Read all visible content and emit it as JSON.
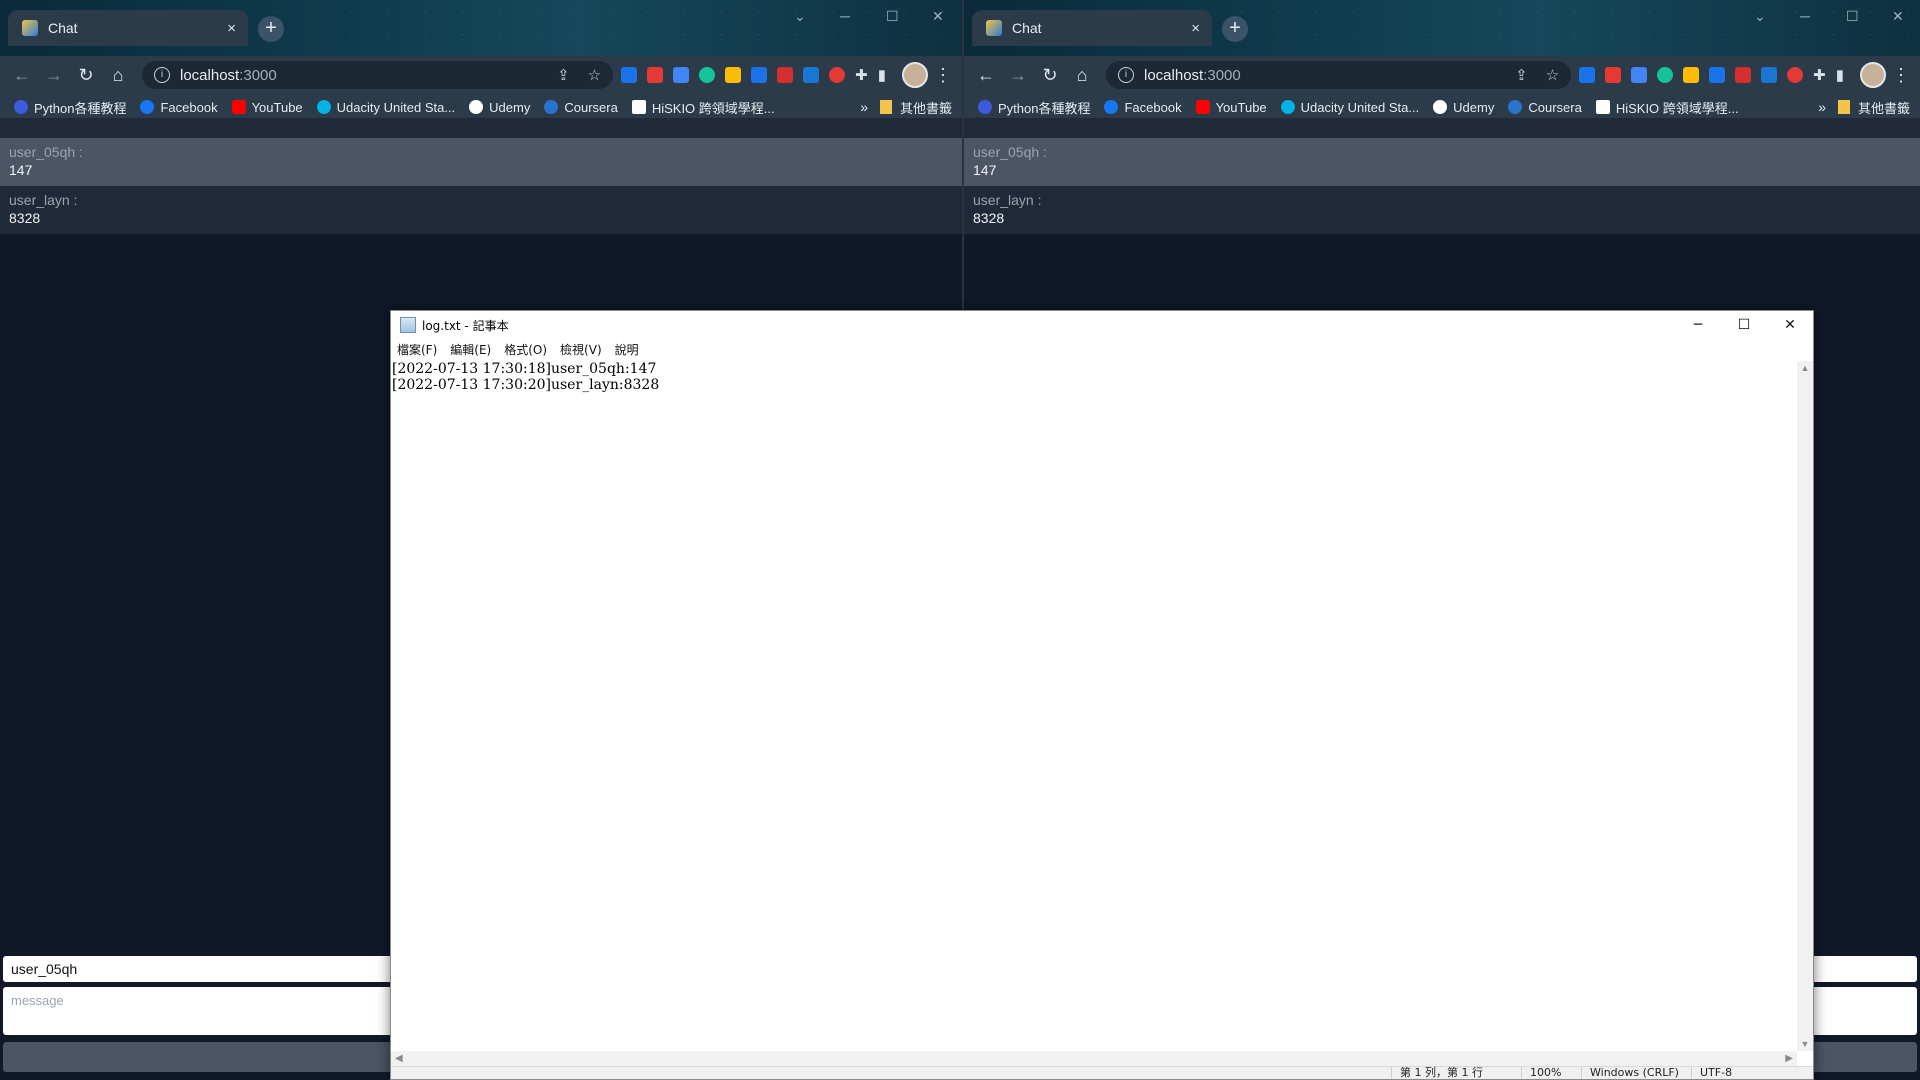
{
  "browser": {
    "tab_title": "Chat",
    "tab_close": "×",
    "new_tab": "+",
    "url_host": "localhost",
    "url_port": ":3000",
    "bookmarks": [
      "Python各種教程",
      "Facebook",
      "YouTube",
      "Udacity United Sta...",
      "Udemy",
      "Coursera",
      "HiSKIO 跨領域學程..."
    ],
    "bookmarks_more": "»",
    "other_bookmarks": "其他書籤",
    "bookmark_icon_colors": [
      "#3b5bdb",
      "#1877f2",
      "#ff0000",
      "#02b3e4",
      "#ffffff",
      "#2a73cc",
      "#ffffff"
    ]
  },
  "chat": {
    "messages": [
      {
        "user": "user_05qh :",
        "text": "147"
      },
      {
        "user": "user_layn :",
        "text": "8328"
      }
    ],
    "left_name_value": "user_05qh",
    "message_placeholder": "message"
  },
  "notepad": {
    "title": "log.txt - 記事本",
    "menu": [
      "檔案(F)",
      "編輯(E)",
      "格式(O)",
      "檢視(V)",
      "說明"
    ],
    "content": "[2022-07-13 17:30:18]user_05qh:147\n[2022-07-13 17:30:20]user_layn:8328",
    "status": [
      "第 1 列，第 1 行",
      "100%",
      "Windows (CRLF)",
      "UTF-8"
    ]
  }
}
